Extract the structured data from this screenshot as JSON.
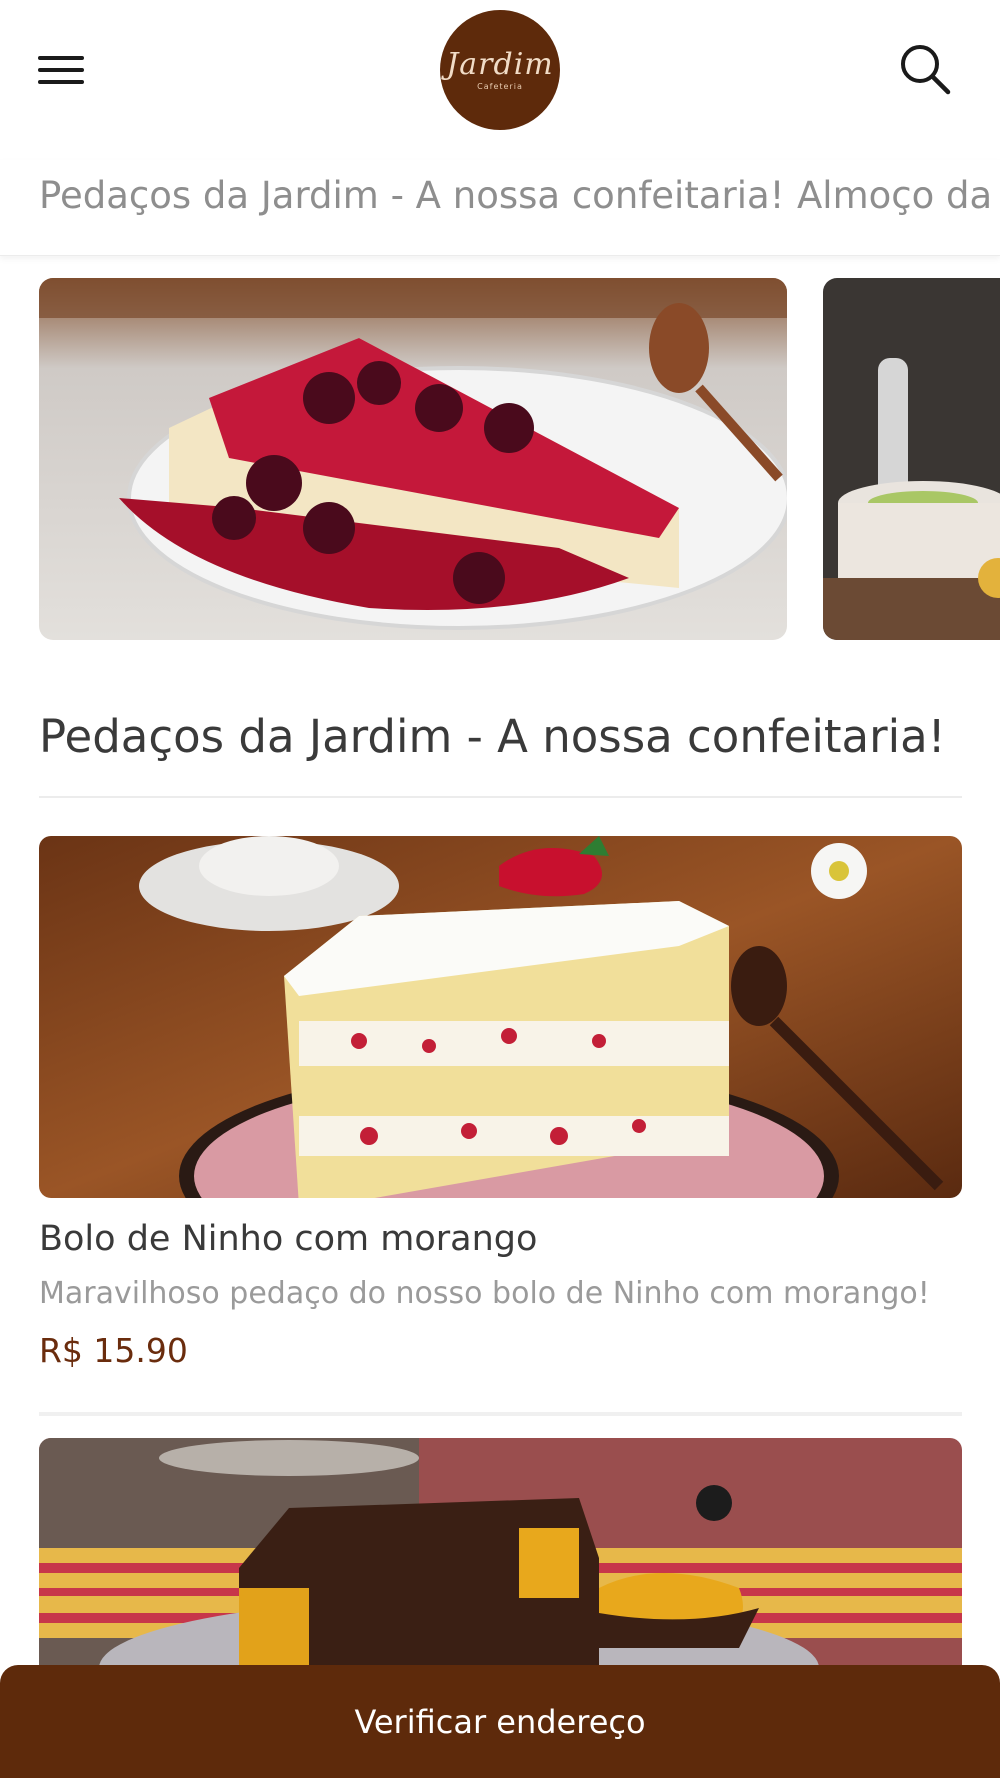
{
  "header": {
    "menu_icon": "hamburger-menu-icon",
    "logo_text": "Jardim",
    "logo_subtext": "Cafeteria",
    "search_icon": "search-icon"
  },
  "categories": [
    "Pedaços da Jardim - A nossa confeitaria!",
    "Almoço da"
  ],
  "section": {
    "title": "Pedaços da Jardim - A nossa confeitaria!"
  },
  "products": [
    {
      "name": "Bolo de Ninho com morango",
      "description": "Maravilhoso pedaço do nosso bolo de Ninho com morango!",
      "price": "R$ 15.90"
    }
  ],
  "bottom_bar": {
    "label": "Verificar endereço"
  },
  "colors": {
    "brand": "#5e2a0b",
    "price": "#6a2c0d",
    "muted_text": "#9a9a9a"
  }
}
